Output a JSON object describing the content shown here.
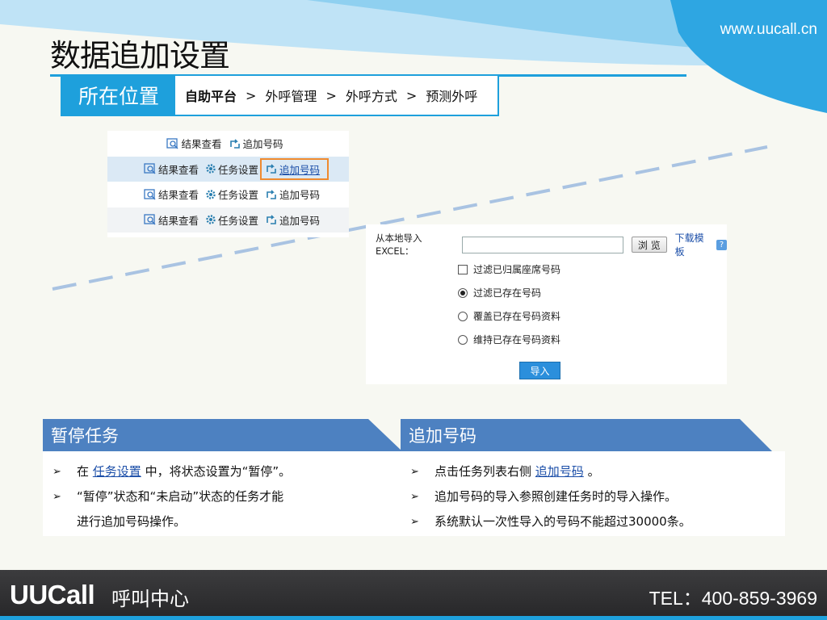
{
  "site_url": "www.uucall.cn",
  "page_title": "数据追加设置",
  "location": {
    "label": "所在位置",
    "crumbs": [
      "自助平台",
      "外呼管理",
      "外呼方式",
      "预测外呼"
    ],
    "separator": ">"
  },
  "task_ops": {
    "result_view": "结果查看",
    "task_settings": "任务设置",
    "add_numbers": "追加号码"
  },
  "import_form": {
    "label": "从本地导入EXCEL：",
    "file_value": "",
    "browse_label": "浏 览",
    "download_template": "下载模板",
    "help": "?",
    "options": [
      {
        "label": "过滤已归属座席号码",
        "type": "checkbox",
        "checked": false
      },
      {
        "label": "过滤已存在号码",
        "type": "radio",
        "checked": true
      },
      {
        "label": "覆盖已存在号码资料",
        "type": "radio",
        "checked": false
      },
      {
        "label": "维持已存在号码资料",
        "type": "radio",
        "checked": false
      }
    ],
    "import_label": "导入"
  },
  "pause_panel": {
    "title": "暂停任务",
    "b1_pre": "在",
    "b1_link": "任务设置",
    "b1_post": "中，将状态设置为“暂停”。",
    "b2_line1": "“暂停”状态和“未启动”状态的任务才能",
    "b2_line2": "进行追加号码操作。"
  },
  "add_panel": {
    "title": "追加号码",
    "b1_pre": "点击任务列表右侧",
    "b1_link": "追加号码",
    "b1_post": "。",
    "b2": "追加号码的导入参照创建任务时的导入操作。",
    "b3": "系统默认一次性导入的号码不能超过30000条。"
  },
  "bullet_glyph": "➢",
  "footer": {
    "brand": "UUCall",
    "brand_sub": "呼叫中心",
    "tel": "TEL：400-859-3969"
  },
  "colors": {
    "accent": "#1ea0dc",
    "panel": "#4d81c1",
    "highlight": "#ef8a2f"
  }
}
